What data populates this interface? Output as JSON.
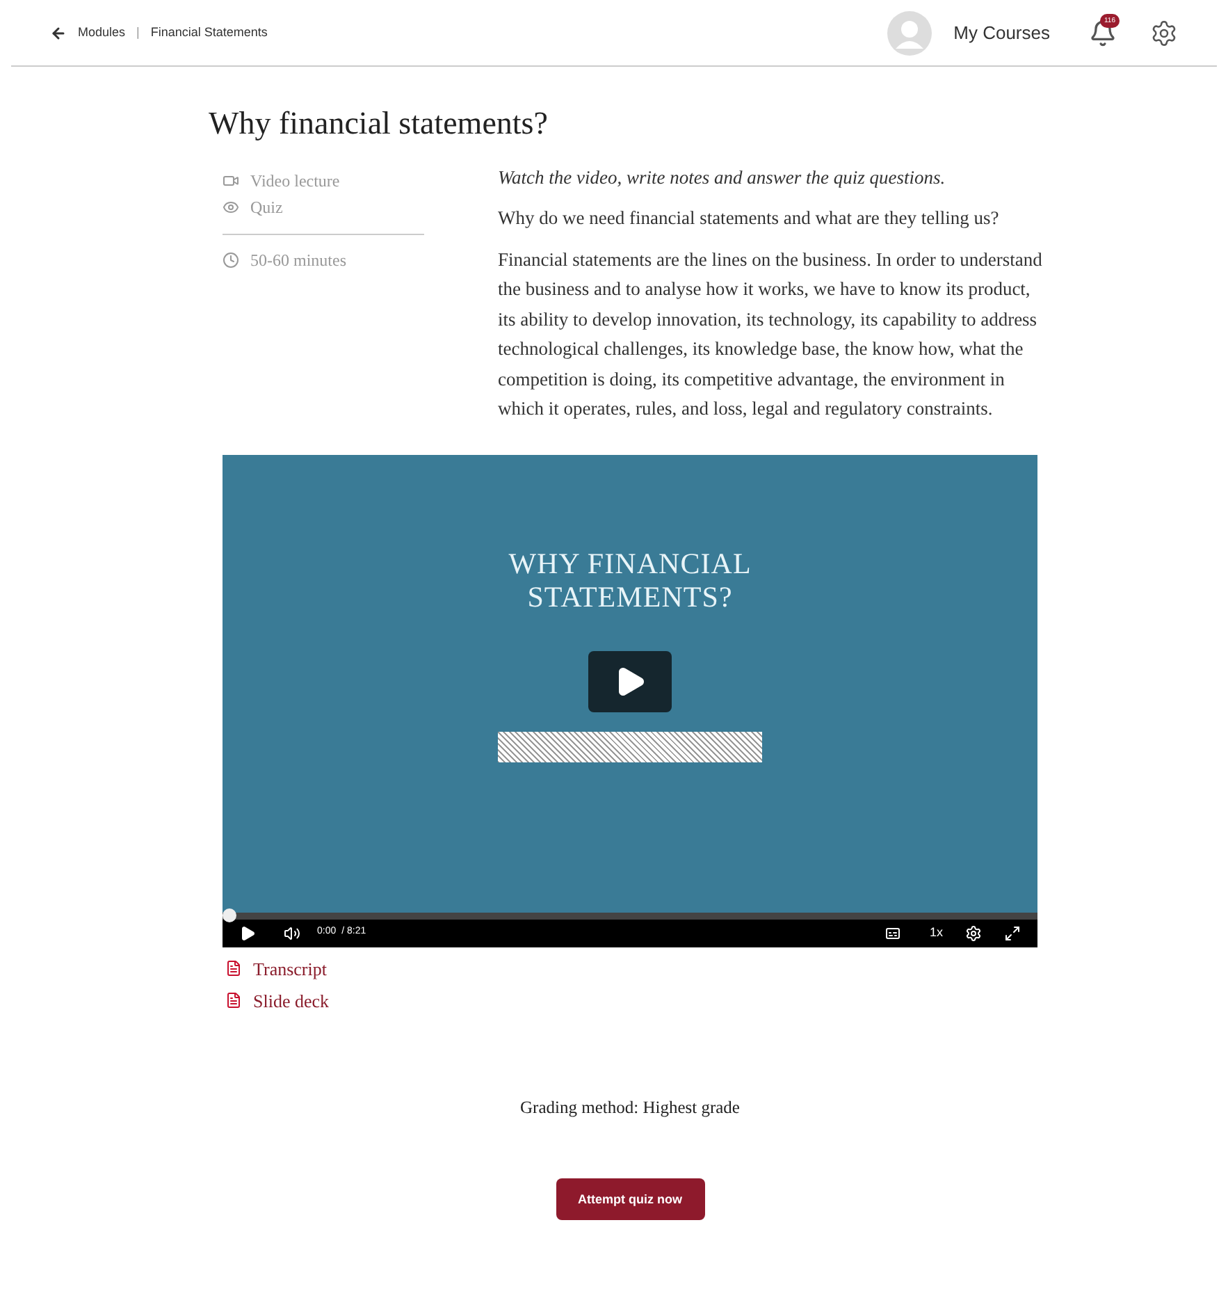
{
  "breadcrumb": {
    "items": [
      "Modules",
      "Financial Statements"
    ],
    "separator": "|"
  },
  "header": {
    "my_courses": "My Courses",
    "notification_count": "116"
  },
  "title": "Why financial statements?",
  "sidebar": {
    "items": [
      {
        "kind": "video",
        "label": "Video lecture"
      },
      {
        "kind": "quiz",
        "label": "Quiz"
      }
    ],
    "duration": "50-60 minutes"
  },
  "intro": "Watch the video, write notes and answer the quiz questions.",
  "paragraphs": [
    "Why do we need financial statements and what are they telling us?",
    "Financial statements are the lines on the business. In order to understand the business and to analyse how it works, we have to know its product, its ability to develop innovation, its technology, its capability to address technological challenges, its knowledge base, the know how, what the competition is doing, its competitive advantage, the environment in which it operates, rules, and loss, legal and regulatory constraints."
  ],
  "video": {
    "slide_title": "WHY FINANCIAL STATEMENTS?",
    "level": 0,
    "current_time": "0:00",
    "duration": "/ 8:21",
    "speed": "1x"
  },
  "attachments": [
    "Transcript",
    "Slide deck"
  ],
  "grading": "Grading method: Highest grade",
  "button": "Attempt quiz now"
}
